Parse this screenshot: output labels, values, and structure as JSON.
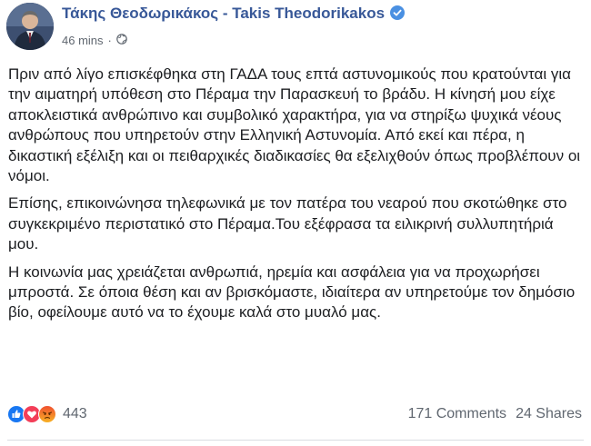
{
  "post": {
    "author_name": "Τάκης Θεοδωρικάκος - Takis Theodorikakos",
    "timestamp": "46 mins",
    "separator": "·",
    "privacy_icon": "globe-icon",
    "verified_icon": "verified-badge-icon",
    "paragraphs": [
      "Πριν από λίγο επισκέφθηκα στη ΓΑΔΑ τους επτά αστυνομικούς που κρατούνται για την αιματηρή υπόθεση στο Πέραμα την Παρασκευή το βράδυ. Η κίνησή μου είχε αποκλειστικά ανθρώπινο και συμβολικό χαρακτήρα, για να στηρίξω ψυχικά νέους ανθρώπους που υπηρετούν στην Ελληνική Αστυνομία. Από εκεί και πέρα, η δικαστική εξέλιξη και οι πειθαρχικές διαδικασίες θα εξελιχθούν όπως προβλέπουν οι νόμοι.",
      "Επίσης, επικοινώνησα τηλεφωνικά με τον πατέρα του νεαρού που σκοτώθηκε στο συγκεκριμένο περιστατικό στο Πέραμα.Του εξέφρασα τα ειλικρινή συλλυπητήριά μου.",
      "Η κοινωνία μας χρειάζεται ανθρωπιά, ηρεμία και ασφάλεια για να προχωρήσει μπροστά. Σε όποια θέση και αν βρισκόμαστε, ιδιαίτερα αν υπηρετούμε τον δημόσιο βίο, οφείλουμε αυτό να το έχουμε καλά στο μυαλό μας."
    ],
    "reactions": {
      "icons": [
        "like-icon",
        "love-icon",
        "angry-icon"
      ],
      "count": "443"
    },
    "comments": "171 Comments",
    "shares": "24 Shares"
  },
  "colors": {
    "author": "#385898",
    "meta": "#606770",
    "like": "#1877f2",
    "love": "#f33e58",
    "angry": "#e9710f"
  }
}
